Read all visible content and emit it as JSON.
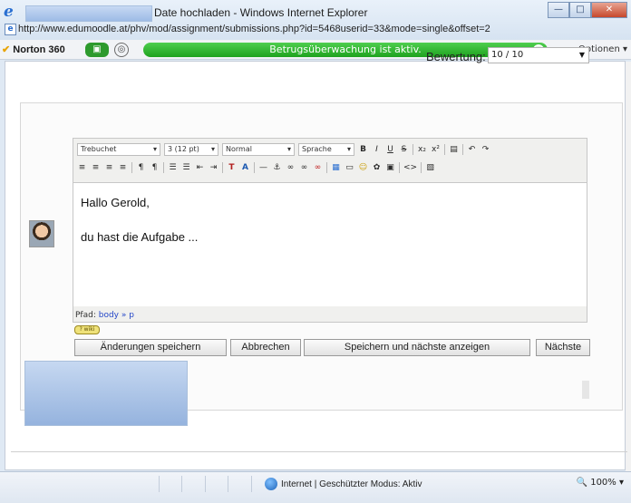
{
  "window": {
    "title": "Date hochladen - Windows Internet Explorer",
    "url": "http://www.edumoodle.at/phv/mod/assignment/submissions.php?id=5468userid=33&mode=single&offset=2",
    "controls": [
      "—",
      "□",
      "✕"
    ]
  },
  "norton": {
    "logo": "Norton 360",
    "status": "Betrugsüberwachung ist aktiv.",
    "options": "Optionen"
  },
  "grade": {
    "label": "Bewertung:",
    "value": "10 / 10"
  },
  "toolbar": {
    "font": "Trebuchet",
    "size": "3 (12 pt)",
    "style": "Normal",
    "lang": "Sprache",
    "row1_icons": [
      "B",
      "I",
      "U",
      "S",
      "x₂",
      "x²",
      "▤",
      "↶",
      "↷"
    ],
    "row2_icons": [
      "≡",
      "≡",
      "≡",
      "≡",
      "¶",
      "¶",
      "☰",
      "☰",
      "⇤",
      "⇥",
      "T",
      "A",
      "—",
      "⚓",
      "∞",
      "∞",
      "∞",
      "▦",
      "▭",
      "☺",
      "✿",
      "▣",
      "<>",
      "▧"
    ]
  },
  "editor": {
    "line1": "Hallo Gerold,",
    "line2": "du hast die Aufgabe ...",
    "path_label": "Pfad:",
    "path_value": "body » p",
    "wiki_chip": "? wiki"
  },
  "buttons": {
    "save": "Änderungen speichern",
    "cancel": "Abbrechen",
    "save_next": "Speichern und nächste anzeigen",
    "next": "Nächste"
  },
  "status": {
    "zone": "Internet | Geschützter Modus: Aktiv",
    "zoom": "100%"
  },
  "colors": {
    "norton_green": "#1ea21e",
    "link_blue": "#2446c8",
    "close_red": "#c6482c"
  }
}
